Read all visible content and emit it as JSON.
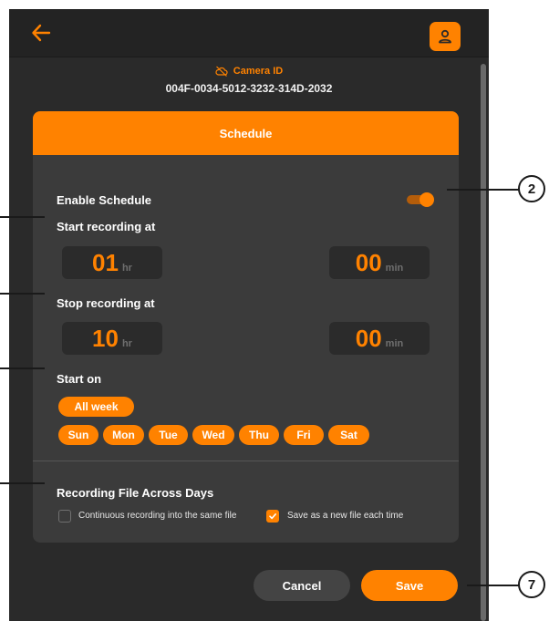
{
  "colors": {
    "accent": "#ff8200",
    "background": "#2a2a2a",
    "card": "#3b3b3b"
  },
  "header": {
    "back_icon": "arrow-left-icon",
    "profile_icon": "user-icon"
  },
  "camera": {
    "icon": "cloud-off-icon",
    "label": "Camera ID",
    "id": "004F-0034-5012-3232-314D-2032"
  },
  "schedule": {
    "title": "Schedule",
    "enable_label": "Enable Schedule",
    "enabled": true,
    "start_label": "Start recording at",
    "start_hour": "01",
    "start_minute": "00",
    "stop_label": "Stop recording at",
    "stop_hour": "10",
    "stop_minute": "00",
    "hr_unit": "hr",
    "min_unit": "min",
    "start_on_label": "Start on",
    "all_week": "All week",
    "days": [
      "Sun",
      "Mon",
      "Tue",
      "Wed",
      "Thu",
      "Fri",
      "Sat"
    ]
  },
  "recording_file": {
    "title": "Recording File Across Days",
    "option_continuous": "Continuous recording into the same file",
    "option_continuous_checked": false,
    "option_new_file": "Save as a new file each time",
    "option_new_file_checked": true
  },
  "actions": {
    "cancel": "Cancel",
    "save": "Save"
  },
  "callouts": {
    "toggle": "2",
    "save": "7"
  }
}
